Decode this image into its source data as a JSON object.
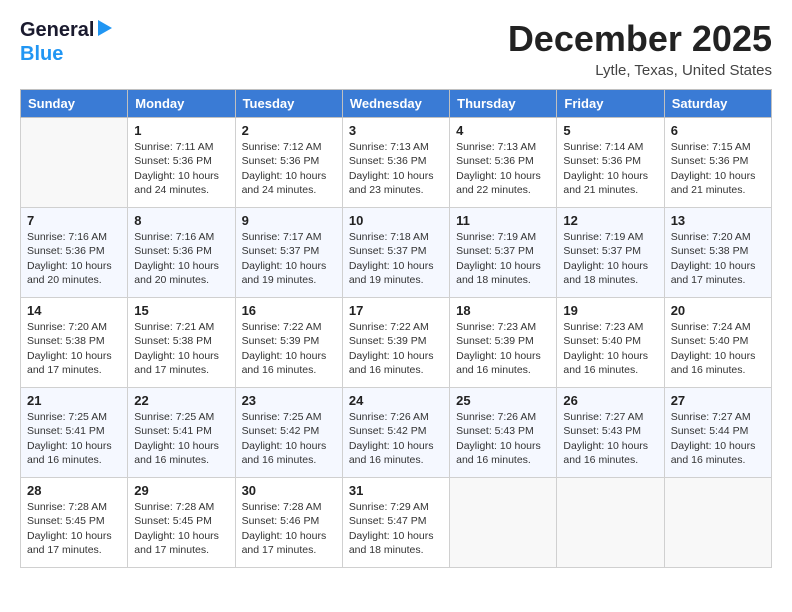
{
  "header": {
    "logo_general": "General",
    "logo_blue": "Blue",
    "title": "December 2025",
    "location": "Lytle, Texas, United States"
  },
  "days_of_week": [
    "Sunday",
    "Monday",
    "Tuesday",
    "Wednesday",
    "Thursday",
    "Friday",
    "Saturday"
  ],
  "weeks": [
    [
      {
        "day": "",
        "sunrise": "",
        "sunset": "",
        "daylight": ""
      },
      {
        "day": "1",
        "sunrise": "Sunrise: 7:11 AM",
        "sunset": "Sunset: 5:36 PM",
        "daylight": "Daylight: 10 hours and 24 minutes."
      },
      {
        "day": "2",
        "sunrise": "Sunrise: 7:12 AM",
        "sunset": "Sunset: 5:36 PM",
        "daylight": "Daylight: 10 hours and 24 minutes."
      },
      {
        "day": "3",
        "sunrise": "Sunrise: 7:13 AM",
        "sunset": "Sunset: 5:36 PM",
        "daylight": "Daylight: 10 hours and 23 minutes."
      },
      {
        "day": "4",
        "sunrise": "Sunrise: 7:13 AM",
        "sunset": "Sunset: 5:36 PM",
        "daylight": "Daylight: 10 hours and 22 minutes."
      },
      {
        "day": "5",
        "sunrise": "Sunrise: 7:14 AM",
        "sunset": "Sunset: 5:36 PM",
        "daylight": "Daylight: 10 hours and 21 minutes."
      },
      {
        "day": "6",
        "sunrise": "Sunrise: 7:15 AM",
        "sunset": "Sunset: 5:36 PM",
        "daylight": "Daylight: 10 hours and 21 minutes."
      }
    ],
    [
      {
        "day": "7",
        "sunrise": "Sunrise: 7:16 AM",
        "sunset": "Sunset: 5:36 PM",
        "daylight": "Daylight: 10 hours and 20 minutes."
      },
      {
        "day": "8",
        "sunrise": "Sunrise: 7:16 AM",
        "sunset": "Sunset: 5:36 PM",
        "daylight": "Daylight: 10 hours and 20 minutes."
      },
      {
        "day": "9",
        "sunrise": "Sunrise: 7:17 AM",
        "sunset": "Sunset: 5:37 PM",
        "daylight": "Daylight: 10 hours and 19 minutes."
      },
      {
        "day": "10",
        "sunrise": "Sunrise: 7:18 AM",
        "sunset": "Sunset: 5:37 PM",
        "daylight": "Daylight: 10 hours and 19 minutes."
      },
      {
        "day": "11",
        "sunrise": "Sunrise: 7:19 AM",
        "sunset": "Sunset: 5:37 PM",
        "daylight": "Daylight: 10 hours and 18 minutes."
      },
      {
        "day": "12",
        "sunrise": "Sunrise: 7:19 AM",
        "sunset": "Sunset: 5:37 PM",
        "daylight": "Daylight: 10 hours and 18 minutes."
      },
      {
        "day": "13",
        "sunrise": "Sunrise: 7:20 AM",
        "sunset": "Sunset: 5:38 PM",
        "daylight": "Daylight: 10 hours and 17 minutes."
      }
    ],
    [
      {
        "day": "14",
        "sunrise": "Sunrise: 7:20 AM",
        "sunset": "Sunset: 5:38 PM",
        "daylight": "Daylight: 10 hours and 17 minutes."
      },
      {
        "day": "15",
        "sunrise": "Sunrise: 7:21 AM",
        "sunset": "Sunset: 5:38 PM",
        "daylight": "Daylight: 10 hours and 17 minutes."
      },
      {
        "day": "16",
        "sunrise": "Sunrise: 7:22 AM",
        "sunset": "Sunset: 5:39 PM",
        "daylight": "Daylight: 10 hours and 16 minutes."
      },
      {
        "day": "17",
        "sunrise": "Sunrise: 7:22 AM",
        "sunset": "Sunset: 5:39 PM",
        "daylight": "Daylight: 10 hours and 16 minutes."
      },
      {
        "day": "18",
        "sunrise": "Sunrise: 7:23 AM",
        "sunset": "Sunset: 5:39 PM",
        "daylight": "Daylight: 10 hours and 16 minutes."
      },
      {
        "day": "19",
        "sunrise": "Sunrise: 7:23 AM",
        "sunset": "Sunset: 5:40 PM",
        "daylight": "Daylight: 10 hours and 16 minutes."
      },
      {
        "day": "20",
        "sunrise": "Sunrise: 7:24 AM",
        "sunset": "Sunset: 5:40 PM",
        "daylight": "Daylight: 10 hours and 16 minutes."
      }
    ],
    [
      {
        "day": "21",
        "sunrise": "Sunrise: 7:25 AM",
        "sunset": "Sunset: 5:41 PM",
        "daylight": "Daylight: 10 hours and 16 minutes."
      },
      {
        "day": "22",
        "sunrise": "Sunrise: 7:25 AM",
        "sunset": "Sunset: 5:41 PM",
        "daylight": "Daylight: 10 hours and 16 minutes."
      },
      {
        "day": "23",
        "sunrise": "Sunrise: 7:25 AM",
        "sunset": "Sunset: 5:42 PM",
        "daylight": "Daylight: 10 hours and 16 minutes."
      },
      {
        "day": "24",
        "sunrise": "Sunrise: 7:26 AM",
        "sunset": "Sunset: 5:42 PM",
        "daylight": "Daylight: 10 hours and 16 minutes."
      },
      {
        "day": "25",
        "sunrise": "Sunrise: 7:26 AM",
        "sunset": "Sunset: 5:43 PM",
        "daylight": "Daylight: 10 hours and 16 minutes."
      },
      {
        "day": "26",
        "sunrise": "Sunrise: 7:27 AM",
        "sunset": "Sunset: 5:43 PM",
        "daylight": "Daylight: 10 hours and 16 minutes."
      },
      {
        "day": "27",
        "sunrise": "Sunrise: 7:27 AM",
        "sunset": "Sunset: 5:44 PM",
        "daylight": "Daylight: 10 hours and 16 minutes."
      }
    ],
    [
      {
        "day": "28",
        "sunrise": "Sunrise: 7:28 AM",
        "sunset": "Sunset: 5:45 PM",
        "daylight": "Daylight: 10 hours and 17 minutes."
      },
      {
        "day": "29",
        "sunrise": "Sunrise: 7:28 AM",
        "sunset": "Sunset: 5:45 PM",
        "daylight": "Daylight: 10 hours and 17 minutes."
      },
      {
        "day": "30",
        "sunrise": "Sunrise: 7:28 AM",
        "sunset": "Sunset: 5:46 PM",
        "daylight": "Daylight: 10 hours and 17 minutes."
      },
      {
        "day": "31",
        "sunrise": "Sunrise: 7:29 AM",
        "sunset": "Sunset: 5:47 PM",
        "daylight": "Daylight: 10 hours and 18 minutes."
      },
      {
        "day": "",
        "sunrise": "",
        "sunset": "",
        "daylight": ""
      },
      {
        "day": "",
        "sunrise": "",
        "sunset": "",
        "daylight": ""
      },
      {
        "day": "",
        "sunrise": "",
        "sunset": "",
        "daylight": ""
      }
    ]
  ]
}
